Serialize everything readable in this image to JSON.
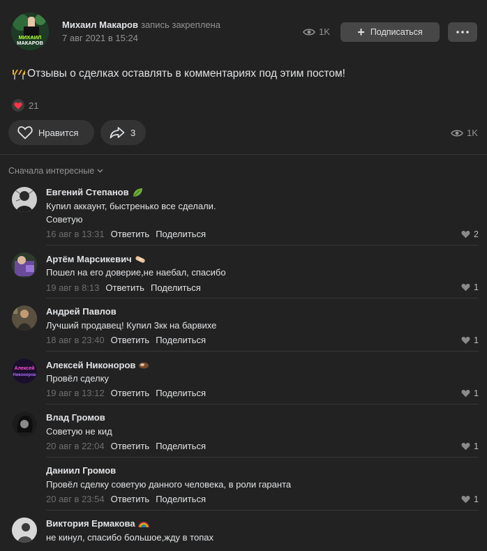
{
  "post": {
    "author": "Михаил Макаров",
    "pinned_note": "запись закреплена",
    "date": "7 авг 2021 в 15:24",
    "views_top": "1K",
    "subscribe_label": "Подписаться",
    "avatar_text_line1": "МИХАИЛ",
    "avatar_text_line2": "МАКАРОВ",
    "text": "Отзывы о сделках оставлять в комментариях под этим постом!",
    "reactions_count": "21",
    "like_label": "Нравится",
    "share_count": "3",
    "views_bottom": "1K"
  },
  "sort_label": "Сначала интересные",
  "colors": {
    "background": "#222222",
    "button": "#474747",
    "pill": "#333333",
    "like_red": "#ff3347"
  },
  "comments": [
    {
      "name": "Евгений Степанов",
      "badge_icon": "leaf-icon",
      "lines": [
        "Купил аккаунт, быстренько все сделали.",
        "Советую"
      ],
      "date": "16 авг в 13:31",
      "reply": "Ответить",
      "share": "Поделиться",
      "likes": "2"
    },
    {
      "name": "Артём Марсикевич",
      "badge_icon": "bandage-icon",
      "lines": [
        "Пошел на его доверие,не наебал, спасибо"
      ],
      "date": "19 авг в 8:13",
      "reply": "Ответить",
      "share": "Поделиться",
      "likes": "1"
    },
    {
      "name": "Андрей Павлов",
      "lines": [
        "Лучший продавец! Купил 3кк на барвихе"
      ],
      "date": "18 авг в 23:40",
      "reply": "Ответить",
      "share": "Поделиться",
      "likes": "1"
    },
    {
      "name": "Алексей Никоноров",
      "badge_icon": "coconut-icon",
      "avatar_text_1": "Алексей",
      "avatar_text_2": "Никоноров",
      "lines": [
        "Провёл сделку"
      ],
      "date": "19 авг в 13:12",
      "reply": "Ответить",
      "share": "Поделиться",
      "likes": "1"
    },
    {
      "name": "Влад Громов",
      "lines": [
        "Советую не кид"
      ],
      "date": "20 авг в 22:04",
      "reply": "Ответить",
      "share": "Поделиться",
      "likes": "1"
    },
    {
      "name": "Даниил Громов",
      "lines": [
        "Провёл сделку советую данного человека, в роли гаранта"
      ],
      "date": "20 авг в 23:54",
      "reply": "Ответить",
      "share": "Поделиться",
      "likes": "1"
    },
    {
      "name": "Виктория Ермакова",
      "badge_icon": "rainbow-icon",
      "lines": [
        "не кинул, спасибо большое,жду в топах"
      ],
      "date": "",
      "reply": "",
      "share": "",
      "likes": ""
    }
  ]
}
